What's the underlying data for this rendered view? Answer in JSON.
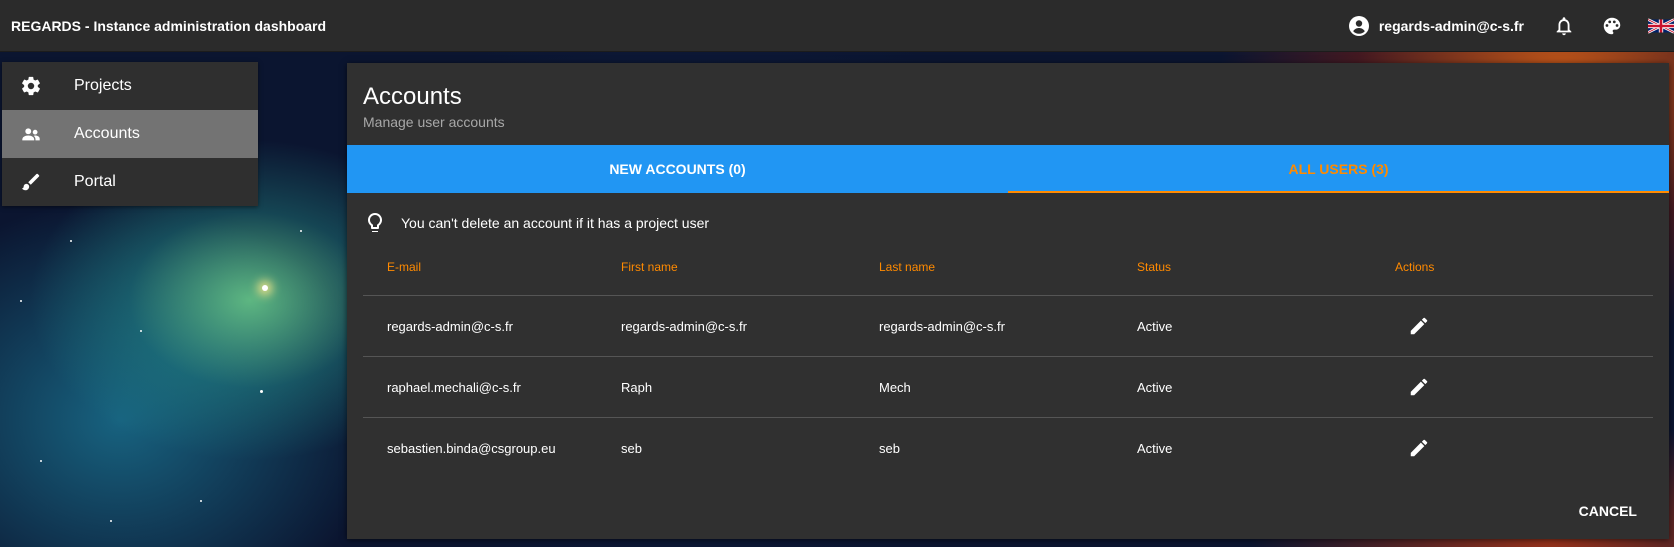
{
  "app": {
    "title": "REGARDS - Instance administration dashboard"
  },
  "topbar": {
    "user_email": "regards-admin@c-s.fr",
    "icons": [
      "account-circle-icon",
      "bell-icon",
      "palette-icon",
      "uk-flag-icon"
    ]
  },
  "sidebar": {
    "items": [
      {
        "label": "Projects",
        "icon": "gear-icon",
        "active": false
      },
      {
        "label": "Accounts",
        "icon": "people-icon",
        "active": true
      },
      {
        "label": "Portal",
        "icon": "brush-icon",
        "active": false
      }
    ]
  },
  "panel": {
    "title": "Accounts",
    "subtitle": "Manage user accounts",
    "tabs": [
      {
        "label": "NEW ACCOUNTS (0)",
        "active": false
      },
      {
        "label": "ALL USERS (3)",
        "active": true
      }
    ],
    "hint": "You can't delete an account if it has a project user",
    "table": {
      "headers": [
        "E-mail",
        "First name",
        "Last name",
        "Status",
        "Actions"
      ],
      "rows": [
        {
          "email": "regards-admin@c-s.fr",
          "first_name": "regards-admin@c-s.fr",
          "last_name": "regards-admin@c-s.fr",
          "status": "Active"
        },
        {
          "email": "raphael.mechali@c-s.fr",
          "first_name": "Raph",
          "last_name": "Mech",
          "status": "Active"
        },
        {
          "email": "sebastien.binda@csgroup.eu",
          "first_name": "seb",
          "last_name": "seb",
          "status": "Active"
        }
      ]
    },
    "cancel_label": "CANCEL"
  },
  "colors": {
    "accent_orange": "#ff8a00",
    "tab_bar_blue": "#2196f3",
    "panel_bg": "#303030",
    "topbar_bg": "#2b2b2b"
  }
}
